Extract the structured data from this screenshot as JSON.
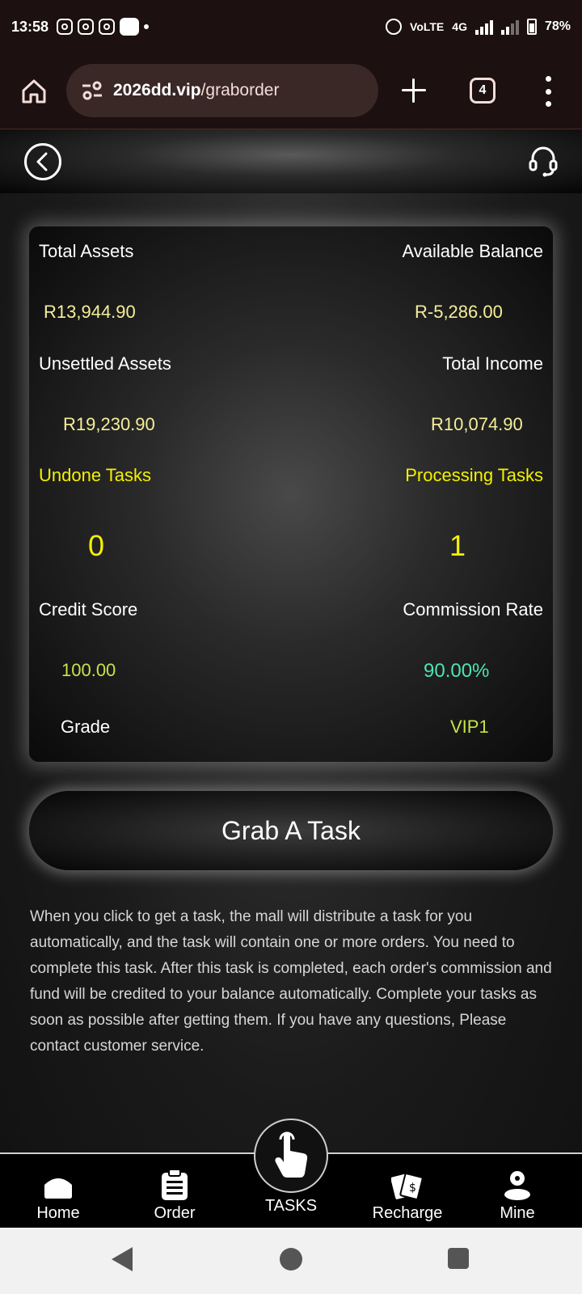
{
  "status_bar": {
    "time": "13:58",
    "network_label": "VoLTE",
    "network_type": "4G",
    "battery": "78%"
  },
  "browser": {
    "url_domain": "2026dd.vip",
    "url_path": "/graborder",
    "tab_count": "4"
  },
  "stats": {
    "total_assets_label": "Total Assets",
    "total_assets_value": "R13,944.90",
    "available_balance_label": "Available Balance",
    "available_balance_value": "R-5,286.00",
    "unsettled_assets_label": "Unsettled Assets",
    "unsettled_assets_value": "R19,230.90",
    "total_income_label": "Total Income",
    "total_income_value": "R10,074.90",
    "undone_tasks_label": "Undone Tasks",
    "undone_tasks_value": "0",
    "processing_tasks_label": "Processing Tasks",
    "processing_tasks_value": "1",
    "credit_score_label": "Credit Score",
    "credit_score_value": "100.00",
    "commission_rate_label": "Commission Rate",
    "commission_rate_value": "90.00%",
    "grade_label": "Grade",
    "grade_value": "VIP1"
  },
  "grab_button_label": "Grab A Task",
  "description": "When you click to get a task, the mall will distribute a task for you automatically, and the task will contain one or more orders. You need to complete this task. After this task is completed, each order's commission and fund will be credited to your balance automatically. Complete your tasks as soon as possible after getting them. If you have any questions, Please contact customer service.",
  "bottom_nav": {
    "home": "Home",
    "order": "Order",
    "tasks": "TASKS",
    "recharge": "Recharge",
    "mine": "Mine"
  },
  "colors": {
    "accent_yellow": "#f4f100",
    "value_yellow": "#f5ee9a",
    "green": "#c6e34a",
    "teal": "#4fe3b0"
  }
}
